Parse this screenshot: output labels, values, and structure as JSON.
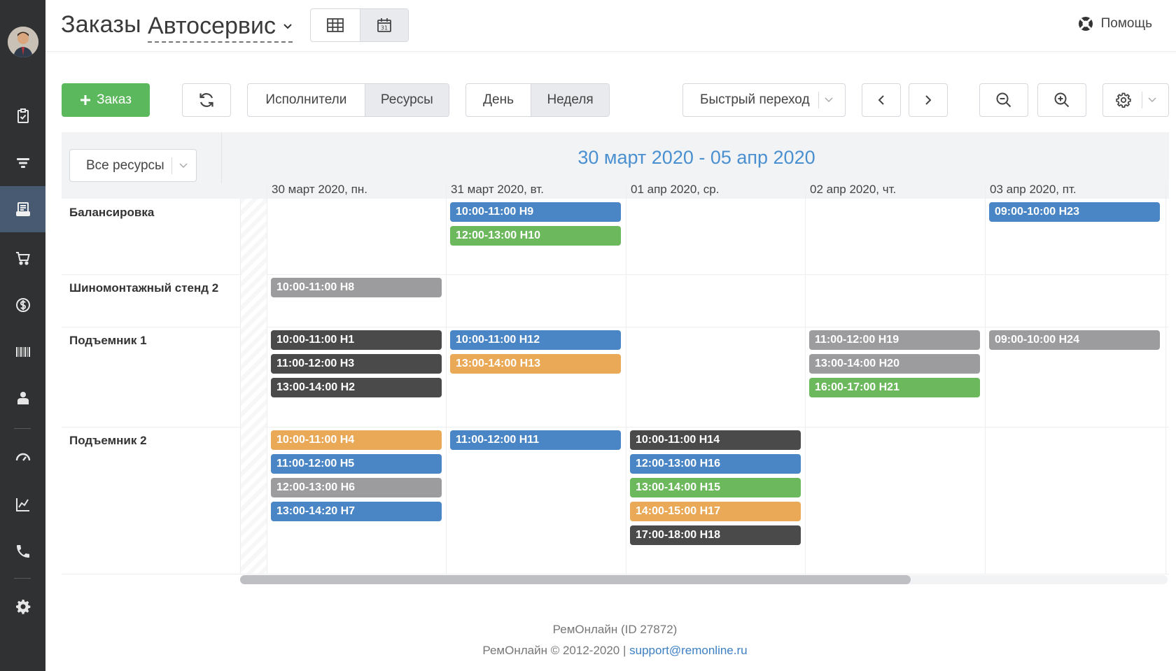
{
  "header": {
    "title": "Заказы",
    "workshop": "Автосервис",
    "help_label": "Помощь"
  },
  "toolbar": {
    "new_order_label": "Заказ",
    "view_by": [
      {
        "label": "Исполнители",
        "active": false
      },
      {
        "label": "Ресурсы",
        "active": true
      }
    ],
    "period": [
      {
        "label": "День",
        "active": false
      },
      {
        "label": "Неделя",
        "active": true
      }
    ],
    "quick_jump_label": "Быстрый переход"
  },
  "calendar": {
    "resource_filter": "Все ресурсы",
    "range_title": "30 март 2020 - 05 апр 2020",
    "days": [
      "30 март 2020, пн.",
      "31 март 2020, вт.",
      "01 апр 2020, ср.",
      "02 апр 2020, чт.",
      "03 апр 2020, пт."
    ],
    "resources": [
      {
        "name": "Балансировка",
        "events": [
          {
            "day": 1,
            "slot": 0,
            "label": "10:00-11:00  Н9",
            "color": "blue"
          },
          {
            "day": 1,
            "slot": 1,
            "label": "12:00-13:00  Н10",
            "color": "green"
          },
          {
            "day": 4,
            "slot": 0,
            "label": "09:00-10:00  Н23",
            "color": "blue"
          }
        ]
      },
      {
        "name": "Шиномонтажный стенд 2",
        "events": [
          {
            "day": 0,
            "slot": 0,
            "label": "10:00-11:00  Н8",
            "color": "gray"
          }
        ]
      },
      {
        "name": "Подъемник 1",
        "events": [
          {
            "day": 0,
            "slot": 0,
            "label": "10:00-11:00  Н1",
            "color": "dark"
          },
          {
            "day": 0,
            "slot": 1,
            "label": "11:00-12:00  Н3",
            "color": "dark"
          },
          {
            "day": 0,
            "slot": 2,
            "label": "13:00-14:00  Н2",
            "color": "dark"
          },
          {
            "day": 1,
            "slot": 0,
            "label": "10:00-11:00  Н12",
            "color": "blue"
          },
          {
            "day": 1,
            "slot": 1,
            "label": "13:00-14:00  Н13",
            "color": "orange"
          },
          {
            "day": 3,
            "slot": 0,
            "label": "11:00-12:00  Н19",
            "color": "gray"
          },
          {
            "day": 3,
            "slot": 1,
            "label": "13:00-14:00  Н20",
            "color": "gray"
          },
          {
            "day": 3,
            "slot": 2,
            "label": "16:00-17:00  Н21",
            "color": "green"
          },
          {
            "day": 4,
            "slot": 0,
            "label": "09:00-10:00  Н24",
            "color": "gray"
          }
        ]
      },
      {
        "name": "Подъемник 2",
        "events": [
          {
            "day": 0,
            "slot": 0,
            "label": "10:00-11:00  Н4",
            "color": "orange"
          },
          {
            "day": 0,
            "slot": 1,
            "label": "11:00-12:00  Н5",
            "color": "blue"
          },
          {
            "day": 0,
            "slot": 2,
            "label": "12:00-13:00  Н6",
            "color": "gray"
          },
          {
            "day": 0,
            "slot": 3,
            "label": "13:00-14:20  Н7",
            "color": "blue"
          },
          {
            "day": 1,
            "slot": 0,
            "label": "11:00-12:00  Н11",
            "color": "blue"
          },
          {
            "day": 2,
            "slot": 0,
            "label": "10:00-11:00  Н14",
            "color": "dark"
          },
          {
            "day": 2,
            "slot": 1,
            "label": "12:00-13:00  Н16",
            "color": "blue"
          },
          {
            "day": 2,
            "slot": 2,
            "label": "13:00-14:00  Н15",
            "color": "green"
          },
          {
            "day": 2,
            "slot": 3,
            "label": "14:00-15:00  Н17",
            "color": "orange"
          },
          {
            "day": 2,
            "slot": 4,
            "label": "17:00-18:00  Н18",
            "color": "dark"
          }
        ]
      }
    ]
  },
  "colors": {
    "blue": "#4a86c5",
    "green": "#6cb85c",
    "gray": "#9c9c9e",
    "dark": "#4a4a4b",
    "orange": "#eaa956",
    "accent": "#5cb85c",
    "active_nav": "#475a72"
  },
  "footer": {
    "line1": "РемОнлайн (ID 27872)",
    "line2_prefix": "РемОнлайн © 2012-2020 | ",
    "support_email": "support@remonline.ru"
  },
  "sidebar": {
    "items": [
      {
        "icon": "clipboard-check-icon"
      },
      {
        "icon": "filter-icon"
      },
      {
        "icon": "orders-icon",
        "active": true
      },
      {
        "icon": "cart-icon"
      },
      {
        "icon": "dollar-icon"
      },
      {
        "icon": "barcode-icon"
      },
      {
        "icon": "person-icon"
      },
      {
        "icon": "gauge-icon"
      },
      {
        "icon": "chart-icon"
      },
      {
        "icon": "phone-icon"
      },
      {
        "icon": "settings-gear-icon"
      }
    ]
  }
}
